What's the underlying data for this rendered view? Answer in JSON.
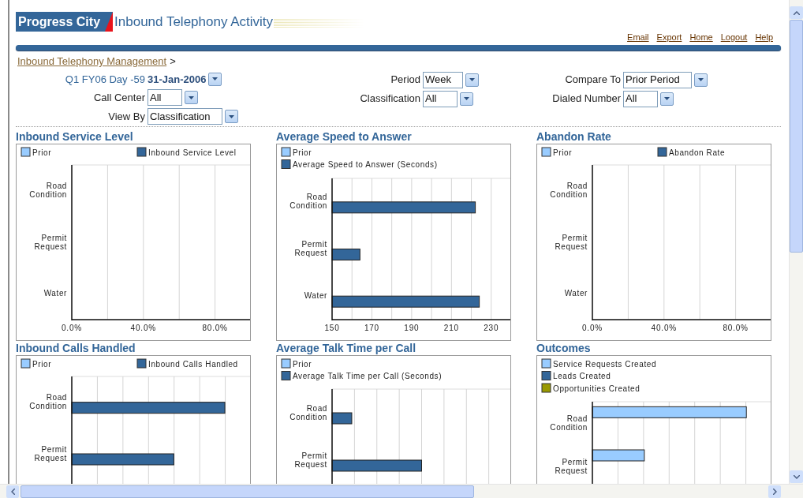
{
  "header": {
    "brand": "Progress City",
    "title": "Inbound Telephony Activity",
    "links": [
      "Email",
      "Export",
      "Home",
      "Logout",
      "Help"
    ]
  },
  "breadcrumb": {
    "link": "Inbound Telephony Management",
    "separator": ">"
  },
  "filter_columns": [
    [
      {
        "kind": "date",
        "label": "Q1 FY06 Day -59",
        "value": "31-Jan-2006"
      },
      {
        "kind": "select",
        "label": "Call Center",
        "value": "All"
      },
      {
        "kind": "select",
        "label": "View By",
        "value": "Classification"
      }
    ],
    [
      {
        "kind": "select",
        "label": "Period",
        "value": "Week"
      },
      {
        "kind": "select",
        "label": "Classification",
        "value": "All"
      }
    ],
    [
      {
        "kind": "select",
        "label": "Compare To",
        "value": "Prior Period"
      },
      {
        "kind": "select",
        "label": "Dialed Number",
        "value": "All"
      }
    ]
  ],
  "panel_rows": [
    [
      {
        "title": "Inbound Service Level",
        "chart_data": {
          "type": "bar",
          "orientation": "horizontal",
          "grid": true,
          "categories": [
            "Road Condition",
            "Permit Request",
            "Water"
          ],
          "series": [
            {
              "name": "Prior",
              "color": "#99ccff",
              "values": [
                null,
                null,
                null
              ]
            },
            {
              "name": "Inbound Service Level",
              "color": "#336699",
              "values": [
                null,
                null,
                null
              ]
            }
          ],
          "xlim": [
            0,
            100
          ],
          "xticks": [
            {
              "value": 0,
              "label": "0.0%"
            },
            {
              "value": 40,
              "label": "40.0%"
            },
            {
              "value": 80,
              "label": "80.0%"
            }
          ]
        }
      },
      {
        "title": "Average Speed to Answer",
        "chart_data": {
          "type": "bar",
          "orientation": "horizontal",
          "grid": true,
          "categories": [
            "Road Condition",
            "Permit Request",
            "Water"
          ],
          "series": [
            {
              "name": "Prior",
              "color": "#99ccff",
              "values": [
                null,
                null,
                null
              ]
            },
            {
              "name": "Average Speed to Answer (Seconds)",
              "color": "#336699",
              "values": [
                222,
                164,
                224
              ]
            }
          ],
          "xlim": [
            150,
            240
          ],
          "xticks": [
            150,
            170,
            190,
            210,
            230
          ]
        }
      },
      {
        "title": "Abandon Rate",
        "chart_data": {
          "type": "bar",
          "orientation": "horizontal",
          "grid": true,
          "categories": [
            "Road Condition",
            "Permit Request",
            "Water"
          ],
          "series": [
            {
              "name": "Prior",
              "color": "#99ccff",
              "values": [
                null,
                null,
                null
              ]
            },
            {
              "name": "Abandon Rate",
              "color": "#336699",
              "values": [
                null,
                null,
                null
              ]
            }
          ],
          "xlim": [
            0,
            100
          ],
          "xticks": [
            {
              "value": 0,
              "label": "0.0%"
            },
            {
              "value": 40,
              "label": "40.0%"
            },
            {
              "value": 80,
              "label": "80.0%"
            }
          ]
        }
      }
    ],
    [
      {
        "title": "Inbound Calls Handled",
        "categories": [
          "Road Condition",
          "Permit Request"
        ],
        "legend": [
          {
            "name": "Prior",
            "color": "#99ccff"
          },
          {
            "name": "Inbound Calls Handled",
            "color": "#336699"
          }
        ]
      },
      {
        "title": "Average Talk Time per Call",
        "categories": [
          "Road Condition",
          "Permit Request"
        ],
        "legend": [
          {
            "name": "Prior",
            "color": "#99ccff"
          },
          {
            "name": "Average Talk Time per Call (Seconds)",
            "color": "#336699"
          }
        ]
      },
      {
        "title": "Outcomes",
        "categories": [
          "Road Condition",
          "Permit Request"
        ],
        "legend": [
          {
            "name": "Service Requests Created",
            "color": "#99ccff"
          },
          {
            "name": "Leads Created",
            "color": "#336699"
          },
          {
            "name": "Opportunities Created",
            "color": "#999900"
          }
        ]
      }
    ]
  ]
}
